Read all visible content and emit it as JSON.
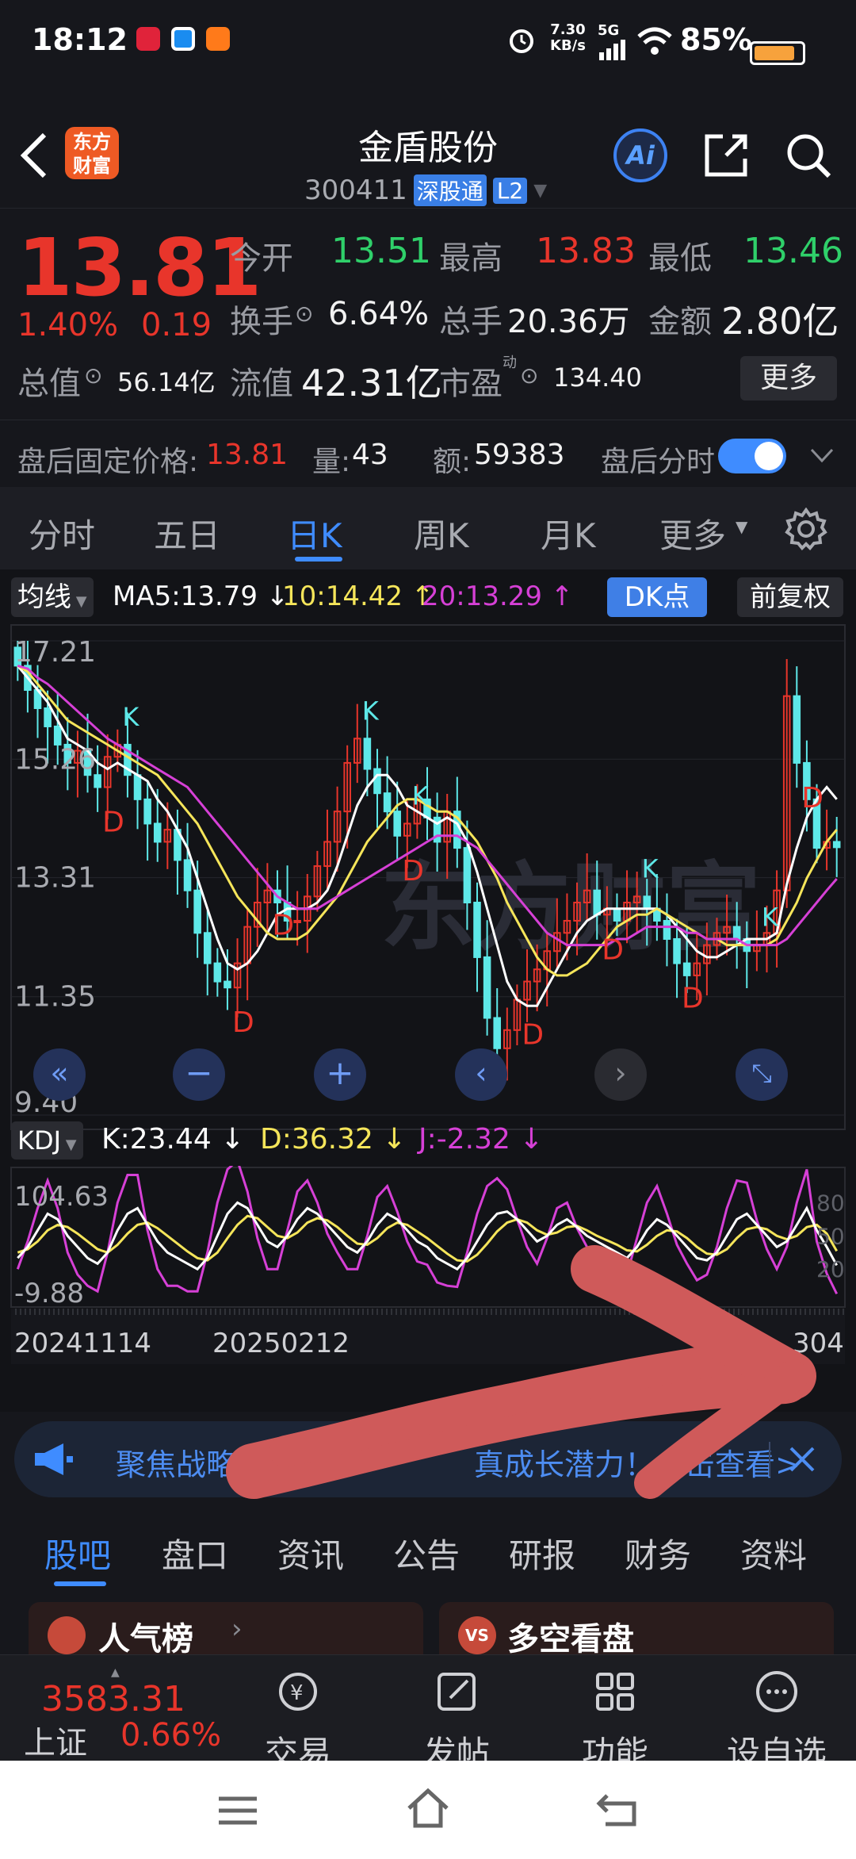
{
  "status_bar": {
    "time": "18:12",
    "net_speed_top": "7.30",
    "net_speed_bottom": "KB/s",
    "network": "5G",
    "battery": "85%"
  },
  "header": {
    "title": "金盾股份",
    "code": "300411",
    "market_tag": "深股通",
    "level_tag": "L2",
    "logo_line1": "东方",
    "logo_line2": "财富",
    "ai_label": "Ai"
  },
  "quote": {
    "price": "13.81",
    "change_pct": "1.40%",
    "change": "0.19",
    "open_label": "今开",
    "open": "13.51",
    "high_label": "最高",
    "high": "13.83",
    "low_label": "最低",
    "low": "13.46",
    "turnover_label": "换手",
    "turnover": "6.64%",
    "volume_label": "总手",
    "volume": "20.36万",
    "amount_label": "金额",
    "amount": "2.80亿",
    "mktcap_label": "总值",
    "mktcap": "56.14亿",
    "float_label": "流值",
    "float": "42.31亿",
    "pe_label": "市盈",
    "pe_sup": "动",
    "pe": "134.40",
    "more_button": "更多",
    "after_hours_label": "盘后固定价格:",
    "after_hours_price": "13.81",
    "ah_volume_label": "量:",
    "ah_volume": "43",
    "ah_amount_label": "额:",
    "ah_amount": "59383",
    "ah_timeshare_label": "盘后分时"
  },
  "period_tabs": {
    "items": [
      "分时",
      "五日",
      "日K",
      "周K",
      "月K",
      "更多"
    ],
    "active": "日K"
  },
  "chart_toolbar": {
    "ma_dropdown": "均线",
    "ma5": "MA5:13.79 ↓",
    "ma10": "10:14.42 ↑",
    "ma20": "20:13.29 ↑",
    "dk_button": "DK点",
    "adjust_button": "前复权"
  },
  "kdj_toolbar": {
    "dropdown": "KDJ",
    "k": "K:23.44 ↓",
    "d": "D:36.32 ↓",
    "j": "J:-2.32 ↓"
  },
  "banner": {
    "text": "聚焦战略",
    "text_tail": "真成长潜力！点击查看>"
  },
  "sub_tabs": {
    "items": [
      "股吧",
      "盘口",
      "资讯",
      "公告",
      "研报",
      "财务",
      "资料"
    ],
    "active": "股吧"
  },
  "cards": {
    "left": "人气榜",
    "right": "多空看盘"
  },
  "bottom_nav": {
    "index_value": "3583.31",
    "index_name": "上证",
    "index_change": "0.66%",
    "trade": "交易",
    "post": "发帖",
    "function": "功能",
    "watchlist": "设自选"
  },
  "colors": {
    "up": "#e8352b",
    "down": "#5ee8e8",
    "ma5": "#ffffff",
    "ma10": "#f5e55a",
    "ma20": "#d640d6",
    "accent": "#3f8cff",
    "annotation": "#cf5a5a"
  },
  "chart_data": {
    "type": "candlestick",
    "y_ticks": [
      "17.21",
      "15.26",
      "13.31",
      "11.35",
      "9.40"
    ],
    "ylim": [
      9.4,
      17.21
    ],
    "x_ticks": [
      "20241114",
      "20250212",
      "304"
    ],
    "signal_markers": [
      "K",
      "D"
    ],
    "kdj_y_ticks": [
      "104.63",
      "-9.88"
    ],
    "kdj_right_ticks": [
      "80",
      "50",
      "20"
    ],
    "kdj_ylim": [
      -9.88,
      104.63
    ],
    "close_series": [
      16.8,
      16.4,
      16.1,
      15.8,
      15.5,
      15.2,
      15.4,
      15.0,
      14.8,
      15.3,
      15.5,
      15.0,
      14.6,
      14.2,
      13.9,
      14.1,
      13.6,
      13.1,
      12.4,
      11.9,
      11.6,
      11.5,
      11.9,
      12.5,
      12.9,
      13.1,
      12.9,
      12.6,
      12.6,
      13.0,
      13.5,
      13.9,
      14.4,
      15.2,
      15.6,
      15.1,
      14.7,
      14.4,
      14.0,
      14.2,
      14.6,
      14.3,
      13.9,
      14.4,
      13.8,
      12.9,
      12.0,
      11.0,
      10.5,
      10.8,
      11.3,
      11.6,
      11.8,
      12.1,
      12.4,
      12.6,
      12.9,
      13.1,
      12.7,
      12.8,
      12.6,
      12.9,
      13.0,
      12.8,
      12.6,
      12.3,
      11.9,
      11.7,
      11.9,
      12.2,
      12.4,
      12.5,
      12.3,
      12.1,
      12.2,
      12.4,
      13.1,
      16.3,
      15.2,
      14.6,
      13.8,
      13.9,
      13.81
    ],
    "ma5": [
      16.8,
      16.6,
      16.4,
      16.2,
      15.9,
      15.6,
      15.5,
      15.4,
      15.2,
      15.1,
      15.2,
      15.1,
      15.0,
      14.9,
      14.6,
      14.4,
      14.1,
      13.8,
      13.3,
      12.8,
      12.3,
      11.9,
      11.8,
      11.9,
      12.1,
      12.4,
      12.7,
      12.8,
      12.8,
      12.8,
      12.9,
      13.1,
      13.5,
      14.0,
      14.5,
      14.8,
      15.0,
      15.0,
      14.8,
      14.5,
      14.4,
      14.3,
      14.2,
      14.3,
      14.2,
      13.9,
      13.4,
      12.8,
      12.2,
      11.6,
      11.3,
      11.2,
      11.2,
      11.5,
      11.8,
      12.1,
      12.4,
      12.6,
      12.7,
      12.8,
      12.8,
      12.8,
      12.8,
      12.8,
      12.8,
      12.7,
      12.5,
      12.3,
      12.1,
      12.0,
      12.0,
      12.1,
      12.2,
      12.3,
      12.3,
      12.3,
      12.4,
      13.2,
      13.8,
      14.3,
      14.6,
      14.8,
      14.6
    ],
    "ma10": [
      16.8,
      16.7,
      16.5,
      16.3,
      16.1,
      15.9,
      15.8,
      15.7,
      15.6,
      15.5,
      15.4,
      15.3,
      15.2,
      15.1,
      15.0,
      14.8,
      14.6,
      14.4,
      14.2,
      13.9,
      13.6,
      13.3,
      13.0,
      12.8,
      12.6,
      12.4,
      12.3,
      12.3,
      12.3,
      12.4,
      12.6,
      12.8,
      13.0,
      13.3,
      13.6,
      13.9,
      14.1,
      14.3,
      14.5,
      14.6,
      14.6,
      14.5,
      14.4,
      14.4,
      14.3,
      14.1,
      13.9,
      13.6,
      13.3,
      12.9,
      12.6,
      12.3,
      12.0,
      11.8,
      11.7,
      11.7,
      11.8,
      11.9,
      12.1,
      12.3,
      12.5,
      12.6,
      12.7,
      12.7,
      12.8,
      12.7,
      12.6,
      12.5,
      12.4,
      12.3,
      12.3,
      12.2,
      12.2,
      12.2,
      12.2,
      12.2,
      12.3,
      12.6,
      12.9,
      13.3,
      13.6,
      13.9,
      14.1
    ],
    "ma20": [
      16.8,
      16.75,
      16.6,
      16.5,
      16.35,
      16.2,
      16.05,
      15.9,
      15.75,
      15.6,
      15.5,
      15.4,
      15.3,
      15.2,
      15.1,
      15.0,
      14.9,
      14.8,
      14.6,
      14.4,
      14.2,
      14.0,
      13.8,
      13.6,
      13.4,
      13.2,
      13.0,
      12.9,
      12.8,
      12.8,
      12.8,
      12.9,
      13.0,
      13.1,
      13.2,
      13.3,
      13.4,
      13.5,
      13.6,
      13.7,
      13.8,
      13.9,
      14.0,
      14.0,
      14.0,
      13.9,
      13.8,
      13.6,
      13.4,
      13.2,
      13.0,
      12.8,
      12.6,
      12.4,
      12.3,
      12.2,
      12.2,
      12.2,
      12.2,
      12.2,
      12.3,
      12.3,
      12.4,
      12.5,
      12.5,
      12.5,
      12.5,
      12.4,
      12.4,
      12.3,
      12.3,
      12.3,
      12.3,
      12.2,
      12.2,
      12.2,
      12.2,
      12.3,
      12.5,
      12.7,
      12.9,
      13.1,
      13.29
    ],
    "kdj_k": [
      30,
      40,
      55,
      70,
      65,
      50,
      40,
      30,
      25,
      35,
      55,
      70,
      75,
      60,
      45,
      35,
      30,
      25,
      20,
      30,
      50,
      70,
      80,
      75,
      60,
      45,
      40,
      50,
      65,
      75,
      70,
      60,
      50,
      40,
      35,
      45,
      60,
      70,
      65,
      55,
      45,
      40,
      30,
      25,
      20,
      30,
      45,
      60,
      70,
      72,
      65,
      55,
      45,
      50,
      60,
      65,
      58,
      50,
      45,
      40,
      35,
      30,
      40,
      55,
      65,
      60,
      50,
      40,
      30,
      28,
      35,
      50,
      65,
      70,
      60,
      50,
      40,
      45,
      60,
      75,
      55,
      40,
      23.44
    ],
    "kdj_d": [
      35,
      38,
      45,
      55,
      60,
      58,
      52,
      45,
      38,
      35,
      42,
      52,
      60,
      62,
      57,
      50,
      43,
      36,
      30,
      28,
      35,
      48,
      60,
      68,
      66,
      58,
      50,
      48,
      53,
      62,
      66,
      64,
      58,
      50,
      43,
      42,
      48,
      57,
      62,
      60,
      54,
      48,
      41,
      34,
      28,
      27,
      33,
      43,
      54,
      62,
      65,
      62,
      55,
      51,
      53,
      58,
      59,
      55,
      50,
      46,
      42,
      37,
      36,
      42,
      50,
      55,
      54,
      48,
      40,
      34,
      33,
      38,
      48,
      56,
      58,
      56,
      50,
      47,
      50,
      58,
      60,
      52,
      36.32
    ],
    "kdj_j": [
      20,
      45,
      75,
      100,
      75,
      35,
      15,
      5,
      0,
      35,
      80,
      105,
      105,
      55,
      20,
      5,
      5,
      0,
      0,
      35,
      80,
      110,
      118,
      90,
      48,
      20,
      20,
      55,
      90,
      100,
      80,
      52,
      35,
      20,
      20,
      50,
      85,
      95,
      72,
      45,
      27,
      24,
      8,
      5,
      4,
      35,
      70,
      95,
      102,
      92,
      65,
      40,
      25,
      48,
      75,
      80,
      57,
      40,
      35,
      28,
      20,
      15,
      48,
      80,
      95,
      70,
      42,
      25,
      10,
      15,
      40,
      75,
      100,
      98,
      64,
      38,
      20,
      40,
      80,
      110,
      45,
      16,
      -2.32
    ]
  }
}
